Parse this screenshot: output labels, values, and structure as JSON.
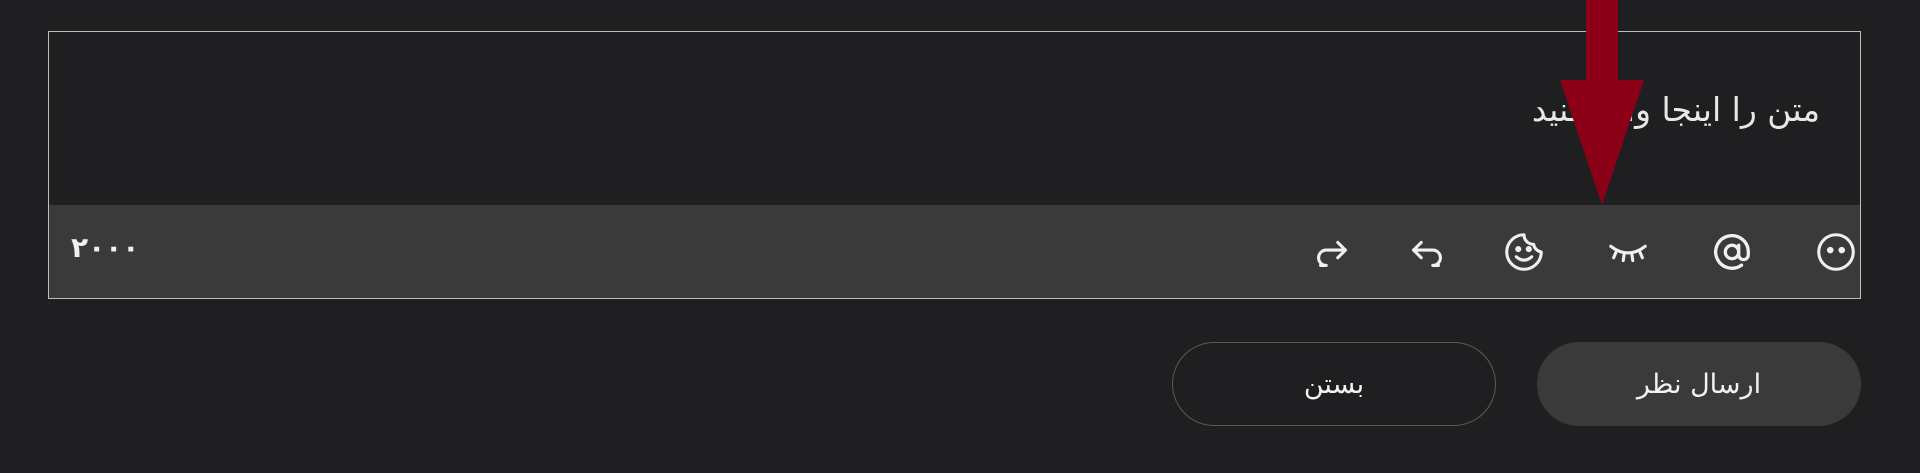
{
  "editor": {
    "placeholder": "متن را اینجا وارد کنید",
    "char_counter": "۲۰۰۰"
  },
  "toolbar": {
    "tools": [
      {
        "name": "emoji-smile-icon"
      },
      {
        "name": "mention-at-icon"
      },
      {
        "name": "spoiler-eye-closed-icon"
      },
      {
        "name": "sticker-face-icon"
      },
      {
        "name": "undo-icon"
      },
      {
        "name": "redo-icon"
      }
    ]
  },
  "actions": {
    "send_label": "ارسال نظر",
    "close_label": "بستن"
  },
  "colors": {
    "background": "#1f1f21",
    "toolbar": "#3a3a3a",
    "annotation_arrow": "#8b0016"
  }
}
